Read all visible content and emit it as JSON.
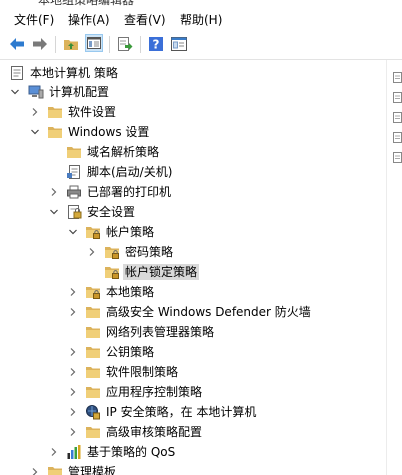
{
  "window": {
    "title": "本地组策略编辑器"
  },
  "menu": [
    {
      "label": "文件(F)"
    },
    {
      "label": "操作(A)"
    },
    {
      "label": "查看(V)"
    },
    {
      "label": "帮助(H)"
    }
  ],
  "toolbar": {
    "back_icon": "arrow-left-icon",
    "forward_icon": "arrow-right-icon",
    "up_icon": "folder-up-icon",
    "show_hide_tree_icon": "console-tree-icon",
    "export_icon": "export-list-icon",
    "help_icon": "help-icon",
    "properties_icon": "properties-icon"
  },
  "tree": {
    "items": [
      {
        "label": "本地计算机 策略",
        "icon": "policy-document-icon",
        "expand": "none"
      },
      {
        "label": "计算机配置",
        "icon": "computer-icon",
        "expand": "expanded"
      },
      {
        "label": "软件设置",
        "icon": "folder-icon",
        "expand": "collapsed"
      },
      {
        "label": "Windows 设置",
        "icon": "folder-icon",
        "expand": "expanded"
      },
      {
        "label": "域名解析策略",
        "icon": "folder-icon",
        "expand": "none"
      },
      {
        "label": "脚本(启动/关机)",
        "icon": "script-icon",
        "expand": "none"
      },
      {
        "label": "已部署的打印机",
        "icon": "printer-icon",
        "expand": "collapsed"
      },
      {
        "label": "安全设置",
        "icon": "security-icon",
        "expand": "expanded"
      },
      {
        "label": "帐户策略",
        "icon": "folder-lock-icon",
        "expand": "expanded"
      },
      {
        "label": "密码策略",
        "icon": "folder-lock-icon",
        "expand": "collapsed"
      },
      {
        "label": "帐户锁定策略",
        "icon": "folder-lock-icon",
        "expand": "none",
        "selected": true
      },
      {
        "label": "本地策略",
        "icon": "folder-lock-icon",
        "expand": "collapsed"
      },
      {
        "label": "高级安全 Windows Defender 防火墙",
        "icon": "folder-icon",
        "expand": "collapsed"
      },
      {
        "label": "网络列表管理器策略",
        "icon": "folder-icon",
        "expand": "none"
      },
      {
        "label": "公钥策略",
        "icon": "folder-icon",
        "expand": "collapsed"
      },
      {
        "label": "软件限制策略",
        "icon": "folder-icon",
        "expand": "collapsed"
      },
      {
        "label": "应用程序控制策略",
        "icon": "folder-icon",
        "expand": "collapsed"
      },
      {
        "label": "IP 安全策略，在 本地计算机",
        "icon": "ip-security-icon",
        "expand": "collapsed"
      },
      {
        "label": "高级审核策略配置",
        "icon": "folder-icon",
        "expand": "collapsed"
      },
      {
        "label": "基于策略的 QoS",
        "icon": "qos-chart-icon",
        "expand": "collapsed"
      },
      {
        "label": "管理模板",
        "icon": "folder-icon",
        "expand": "collapsed"
      }
    ]
  },
  "colors": {
    "folder": "#dcb35c",
    "folder_light": "#f5d98a",
    "toolbar_arrow": "#2e7bcf",
    "selected_bg": "#d9d9d9",
    "help_blue": "#3b6fd8"
  }
}
